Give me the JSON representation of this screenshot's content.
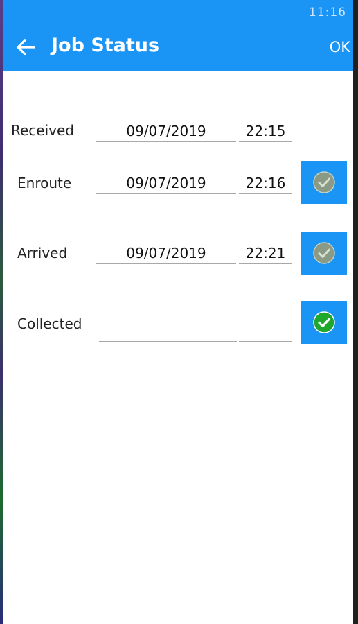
{
  "status_bar": {
    "time": "11:16"
  },
  "app_bar": {
    "title": "Job Status",
    "ok_label": "OK"
  },
  "rows": [
    {
      "label": "Received",
      "date": "09/07/2019",
      "time": "22:15",
      "has_button": false
    },
    {
      "label": "Enroute",
      "date": "09/07/2019",
      "time": "22:16",
      "has_button": true,
      "button_state": "completed",
      "icon": "check-circle-grey"
    },
    {
      "label": "Arrived",
      "date": "09/07/2019",
      "time": "22:21",
      "has_button": true,
      "button_state": "completed",
      "icon": "check-circle-grey"
    },
    {
      "label": "Collected",
      "date": "",
      "time": "",
      "has_button": true,
      "button_state": "active",
      "icon": "check-circle-green"
    }
  ],
  "colors": {
    "accent": "#1a94f5",
    "check_active": "#1fa82e",
    "check_done": "#8a9a84"
  }
}
